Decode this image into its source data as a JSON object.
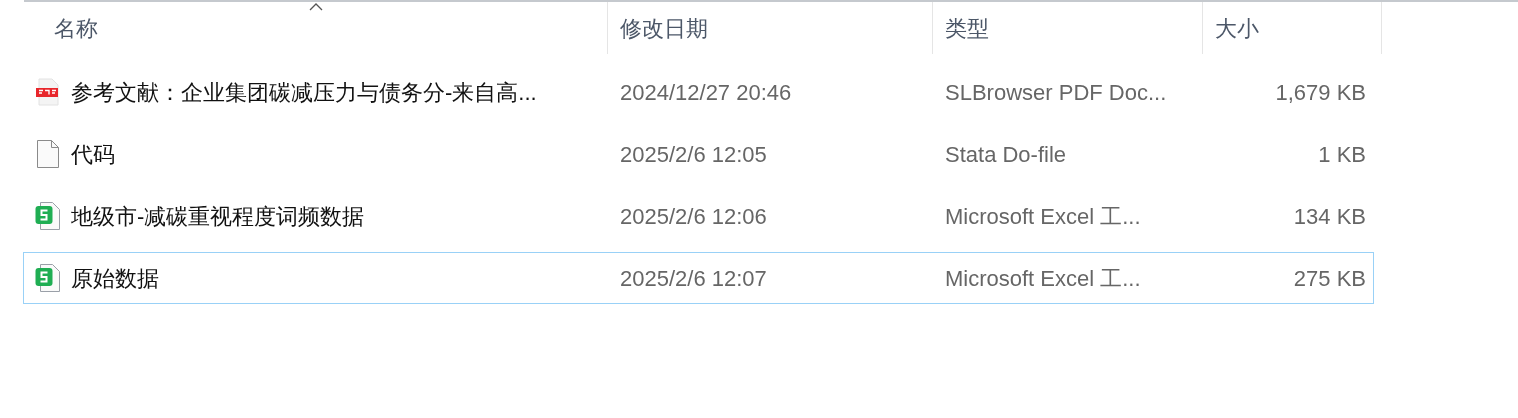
{
  "columns": [
    {
      "label": "名称",
      "sorted": true
    },
    {
      "label": "修改日期",
      "sorted": false
    },
    {
      "label": "类型",
      "sorted": false
    },
    {
      "label": "大小",
      "sorted": false
    }
  ],
  "rows": [
    {
      "kind": "pdf",
      "name": "参考文献：企业集团碳减压力与债务分-来自高...",
      "modified": "2024/12/27 20:46",
      "type": "SLBrowser PDF Doc...",
      "size": "1,679 KB",
      "focused": false
    },
    {
      "kind": "file",
      "name": "代码",
      "modified": "2025/2/6 12:05",
      "type": "Stata Do-file",
      "size": "1 KB",
      "focused": false
    },
    {
      "kind": "sheet",
      "name": "地级市-减碳重视程度词频数据",
      "modified": "2025/2/6 12:06",
      "type": "Microsoft Excel 工...",
      "size": "134 KB",
      "focused": false
    },
    {
      "kind": "sheet",
      "name": "原始数据",
      "modified": "2025/2/6 12:07",
      "type": "Microsoft Excel 工...",
      "size": "275 KB",
      "focused": true
    }
  ]
}
